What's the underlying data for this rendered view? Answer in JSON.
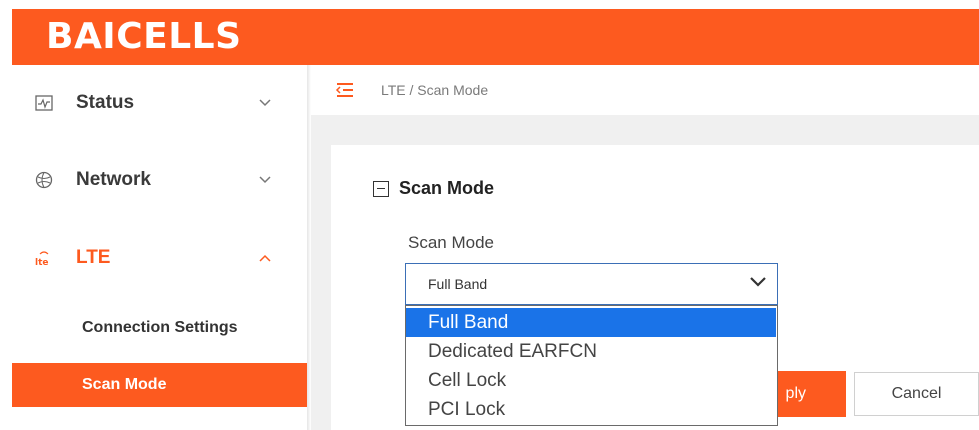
{
  "header": {
    "logo_text": "BAICELLS",
    "brand_color": "#fd5a1f"
  },
  "sidebar": {
    "items": [
      {
        "label": "Status",
        "icon": "status-monitor-icon",
        "expanded": false
      },
      {
        "label": "Network",
        "icon": "globe-icon",
        "expanded": false
      },
      {
        "label": "LTE",
        "icon": "lte-icon",
        "expanded": true
      }
    ],
    "subitems": [
      {
        "label": "Connection Settings",
        "active": false
      },
      {
        "label": "Scan Mode",
        "active": true
      }
    ]
  },
  "breadcrumb": {
    "icon": "menu-collapse-icon",
    "text": "LTE / Scan Mode"
  },
  "section": {
    "title": "Scan Mode",
    "icon": "collapse-minus-icon"
  },
  "form": {
    "field_label": "Scan Mode",
    "selected_value": "Full Band",
    "options": [
      "Full Band",
      "Dedicated EARFCN",
      "Cell Lock",
      "PCI Lock"
    ],
    "highlighted_color": "#1a73e8"
  },
  "buttons": {
    "apply_visible": "ply",
    "cancel": "Cancel"
  }
}
